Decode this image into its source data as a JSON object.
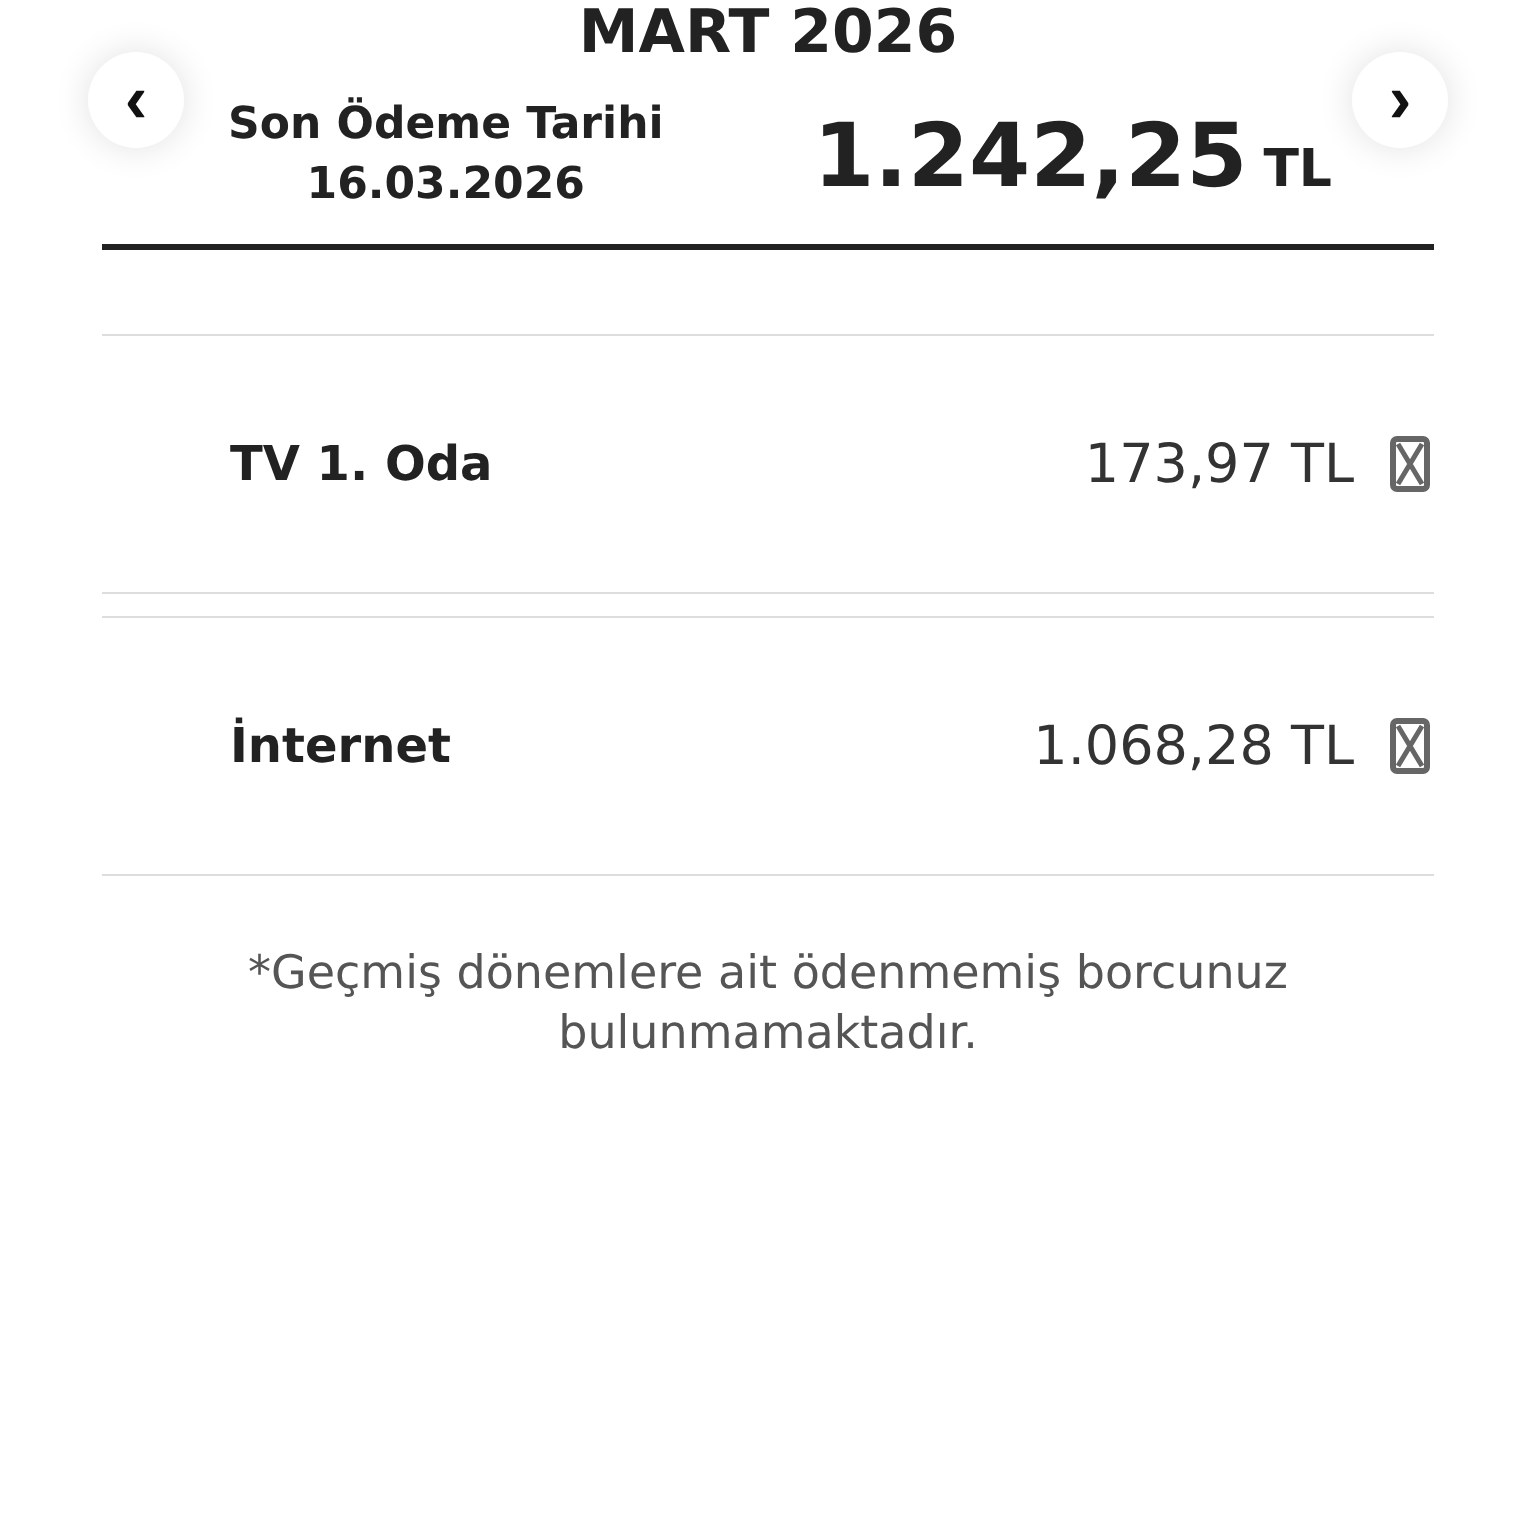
{
  "period": {
    "title": "MART 2026",
    "prev": "‹",
    "next": "›"
  },
  "summary": {
    "due_label": "Son Ödeme Tarihi",
    "due_date": "16.03.2026",
    "total": "1.242,25",
    "currency": "TL"
  },
  "items": [
    {
      "name": "TV 1. Oda",
      "amount": "173,97 TL"
    },
    {
      "name": "İnternet",
      "amount": "1.068,28 TL"
    }
  ],
  "note": "*Geçmiş dönemlere ait ödenmemiş borcunuz bulunmamaktadır."
}
